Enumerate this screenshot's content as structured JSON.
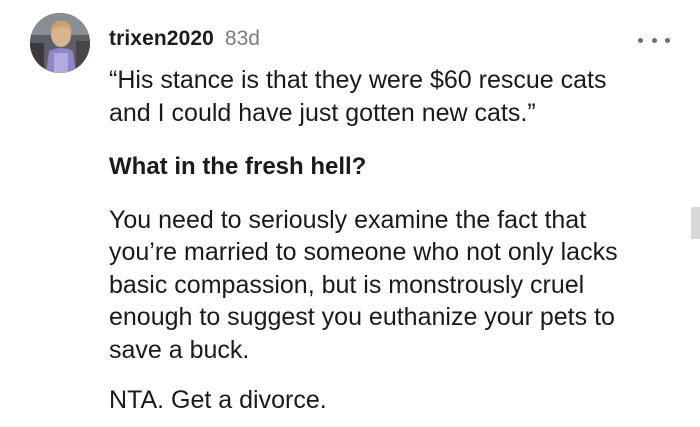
{
  "comment": {
    "username": "trixen2020",
    "age": "83d",
    "more_icon": "more-horizontal-icon",
    "quote_line1": "“His stance is that they were $60 rescue cats",
    "quote_line2": "and I could have just gotten new cats.”",
    "bold_line": "What in the fresh hell?",
    "para_line1": "You need to seriously examine the fact that",
    "para_line2": "you’re married to someone who not only lacks",
    "para_line3": "basic compassion, but is monstrously cruel",
    "para_line4": "enough to suggest you euthanize your pets to",
    "para_line5": "save a buck.",
    "closing": "NTA. Get a divorce."
  },
  "colors": {
    "username": "#1c1c1c",
    "timestamp": "#7c7c7c",
    "body_text": "#1a1a1a",
    "scrollbar": "#d8d8d8"
  }
}
